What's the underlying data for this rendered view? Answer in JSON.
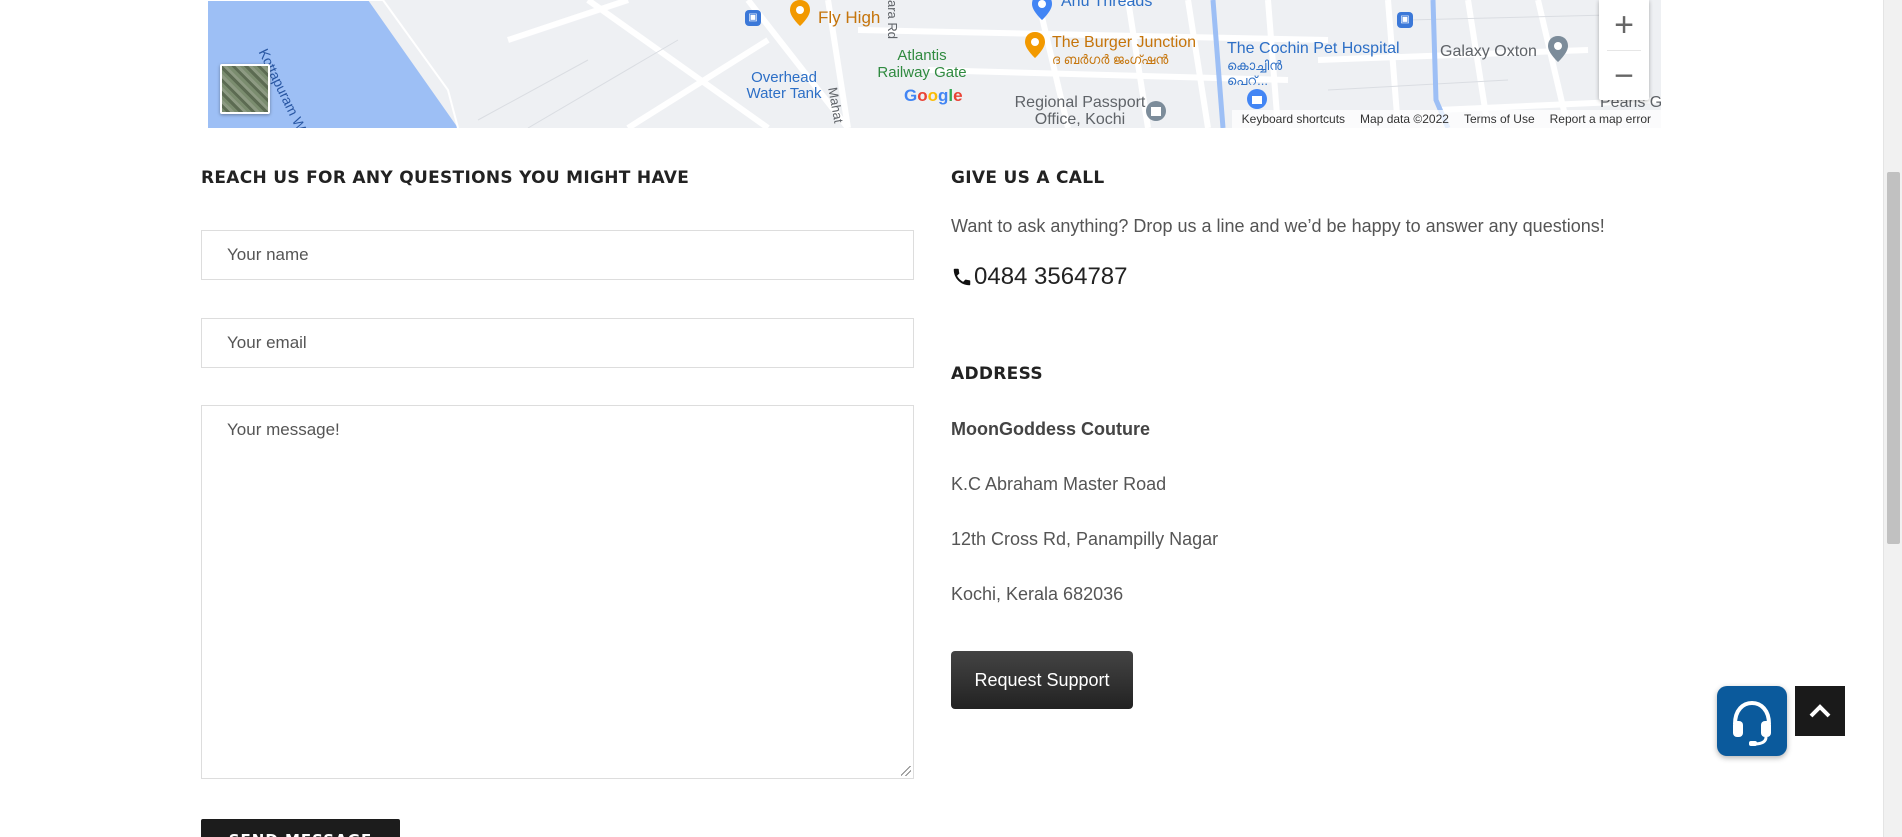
{
  "map": {
    "labels": {
      "waterway": "Kottapuram Waterway",
      "fly_high": "Fly High",
      "anu_threads": "Anu Threads",
      "road_ara": "ara Rd",
      "atlantis": "Atlantis Railway Gate",
      "burger": "The Burger Junction",
      "burger_ml": "ദ ബർഗർ ജംഗ്ഷൻ",
      "pet_hospital": "The Cochin Pet Hospital",
      "pet_ml": "കൊച്ചിൻ പെറ്...",
      "galaxy": "Galaxy Oxton",
      "overhead": "Overhead Water Tank",
      "mahat": "Mahat",
      "passport": "Regional Passport Office, Kochi",
      "pearls": "Pearls Garde"
    },
    "zoom_in": "+",
    "zoom_out": "−",
    "google": [
      "G",
      "o",
      "o",
      "g",
      "l",
      "e"
    ],
    "footer": {
      "shortcuts": "Keyboard shortcuts",
      "map_data": "Map data ©2022",
      "terms": "Terms of Use",
      "report": "Report a map error"
    }
  },
  "form": {
    "heading": "REACH US FOR ANY QUESTIONS YOU MIGHT HAVE",
    "name_placeholder": "Your name",
    "email_placeholder": "Your email",
    "message_placeholder": "Your message!",
    "send_label": "SEND MESSAGE"
  },
  "call": {
    "heading": "GIVE US A CALL",
    "description": "Want to ask anything? Drop us a line and we’d be happy to answer any questions!",
    "phone": "0484 3564787"
  },
  "address": {
    "heading": "ADDRESS",
    "company": "MoonGoddess Couture",
    "line1": "K.C Abraham Master Road",
    "line2": "12th Cross Rd, Panampilly Nagar",
    "line3": "Kochi, Kerala 682036"
  },
  "support": {
    "button_label": "Request Support"
  },
  "colors": {
    "water": "#9dbff5",
    "help_widget": "#0b5a9c",
    "button_dark": "#1c1c1c"
  }
}
